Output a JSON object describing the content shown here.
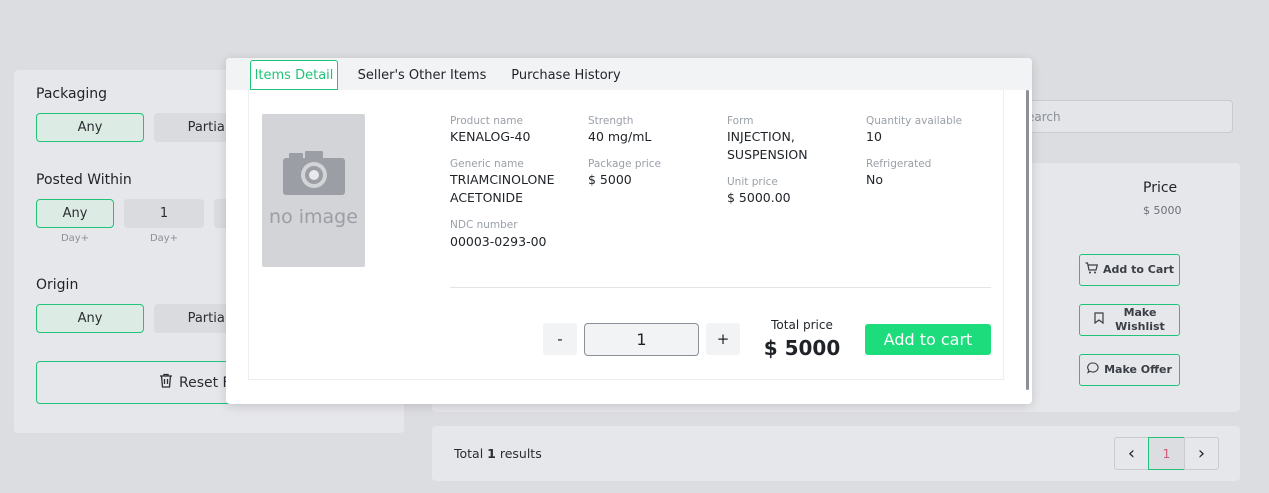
{
  "filters": {
    "packaging": {
      "title": "Packaging",
      "options": [
        "Any",
        "Partial"
      ]
    },
    "posted_within": {
      "title": "Posted Within",
      "options": [
        {
          "label": "Any",
          "sub": "Day+"
        },
        {
          "label": "1",
          "sub": "Day+"
        }
      ]
    },
    "origin": {
      "title": "Origin",
      "options": [
        "Any",
        "Partial"
      ]
    },
    "reset_label": "Reset F"
  },
  "search": {
    "placeholder": "earch"
  },
  "listing": {
    "price_header": "Price",
    "price_value": "$ 5000",
    "actions": {
      "add_to_cart": "Add to Cart",
      "make_wishlist": "Make Wishlist",
      "make_offer": "Make Offer"
    }
  },
  "footer": {
    "total_prefix": "Total ",
    "total_count": "1",
    "total_suffix": " results",
    "pagination": {
      "prev": "‹",
      "current": "1",
      "next": "›"
    }
  },
  "modal": {
    "tabs": [
      "Items Detail",
      "Seller's Other Items",
      "Purchase History"
    ],
    "active_tab": "Items Detail",
    "image_text": "no image",
    "fields": {
      "product_name": {
        "label": "Product name",
        "value": "KENALOG-40"
      },
      "generic_name": {
        "label": "Generic name",
        "value": "TRIAMCINOLONE ACETONIDE"
      },
      "ndc_number": {
        "label": "NDC number",
        "value": "00003-0293-00"
      },
      "strength": {
        "label": "Strength",
        "value": "40 mg/mL"
      },
      "package_price": {
        "label": "Package price",
        "value": "$ 5000"
      },
      "form": {
        "label": "Form",
        "value": "INJECTION, SUSPENSION"
      },
      "unit_price": {
        "label": "Unit price",
        "value": "$ 5000.00"
      },
      "quantity_available": {
        "label": "Quantity available",
        "value": "10"
      },
      "refrigerated": {
        "label": "Refrigerated",
        "value": "No"
      }
    },
    "quantity": {
      "minus": "-",
      "value": "1",
      "plus": "+"
    },
    "total": {
      "label": "Total price",
      "value": "$ 5000"
    },
    "add_to_cart": "Add to cart"
  },
  "colors": {
    "accent": "#21c37a",
    "add_button": "#1cdc7c",
    "backdrop": "#dcdde0"
  }
}
